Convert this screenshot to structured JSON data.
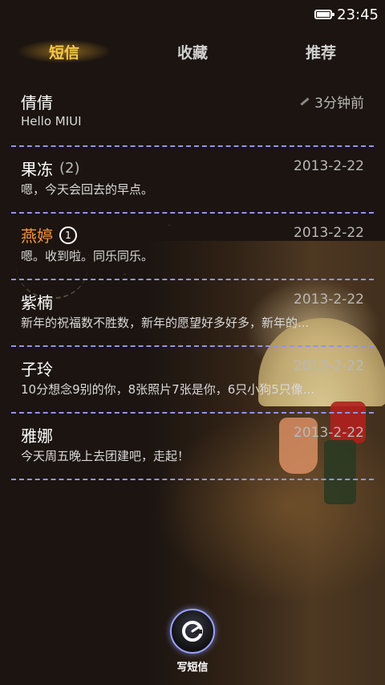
{
  "status_bar": {
    "time": "23:45",
    "battery_icon": "battery-full-icon"
  },
  "tabs": [
    {
      "label": "短信",
      "active": true
    },
    {
      "label": "收藏",
      "active": false
    },
    {
      "label": "推荐",
      "active": false
    }
  ],
  "conversations": [
    {
      "name": "倩倩",
      "count": "",
      "badge": "",
      "time": "3分钟前",
      "preview": "Hello MIUI",
      "highlight": false,
      "draft_icon": "pencil-icon"
    },
    {
      "name": "果冻",
      "count": "(2)",
      "badge": "",
      "time": "2013-2-22",
      "preview": "嗯，今天会回去的早点。",
      "highlight": false
    },
    {
      "name": "燕婷",
      "count": "",
      "badge": "1",
      "time": "2013-2-22",
      "preview": "嗯。收到啦。同乐同乐。",
      "highlight": true
    },
    {
      "name": "紫楠",
      "count": "",
      "badge": "",
      "time": "2013-2-22",
      "preview": "新年的祝福数不胜数，新年的愿望好多好多，新年的...",
      "highlight": false
    },
    {
      "name": "子玲",
      "count": "",
      "badge": "",
      "time": "2013-2-22",
      "preview": "10分想念9别的你，8张照片7张是你，6只小狗5只像...",
      "highlight": false
    },
    {
      "name": "雅娜",
      "count": "",
      "badge": "",
      "time": "2013-2-22",
      "preview": "今天周五晚上去团建吧，走起！",
      "highlight": false
    }
  ],
  "compose": {
    "label": "写短信",
    "icon": "compose-message-icon"
  },
  "colors": {
    "accent_tab": "#f5c84a",
    "highlight_name": "#f5963a",
    "divider": "#8f95e8"
  }
}
